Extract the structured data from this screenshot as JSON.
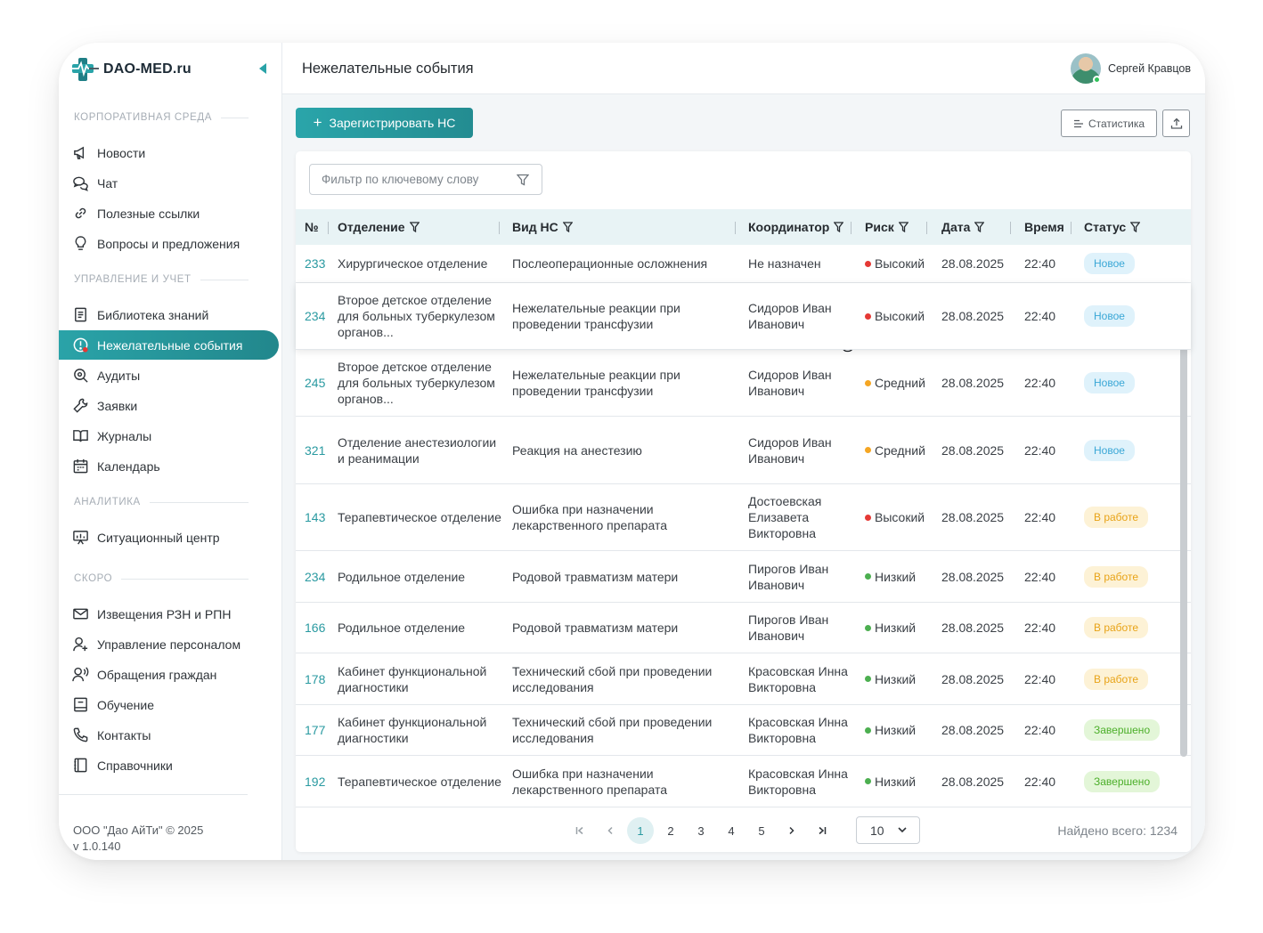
{
  "app": {
    "logo_text": "DAO-MED.ru"
  },
  "sidebar": {
    "sections": [
      {
        "title": "КОРПОРАТИВНАЯ СРЕДА"
      },
      {
        "title": "УПРАВЛЕНИЕ И УЧЕТ"
      },
      {
        "title": "АНАЛИТИКА"
      },
      {
        "title": "СКОРО"
      }
    ],
    "items": [
      {
        "label": "Новости",
        "icon": "megaphone-icon"
      },
      {
        "label": "Чат",
        "icon": "chat-icon"
      },
      {
        "label": "Полезные ссылки",
        "icon": "link-icon"
      },
      {
        "label": "Вопросы и предложения",
        "icon": "lightbulb-icon"
      },
      {
        "label": "Библиотека знаний",
        "icon": "book-list-icon"
      },
      {
        "label": "Нежелательные события",
        "icon": "alert-circle-icon",
        "active": true
      },
      {
        "label": "Аудиты",
        "icon": "magnifier-icon"
      },
      {
        "label": "Заявки",
        "icon": "wrench-icon"
      },
      {
        "label": "Журналы",
        "icon": "open-book-icon"
      },
      {
        "label": "Календарь",
        "icon": "calendar-icon"
      },
      {
        "label": "Ситуационный центр",
        "icon": "presentation-icon"
      },
      {
        "label": "Извещения РЗН и РПН",
        "icon": "mail-icon"
      },
      {
        "label": "Управление персоналом",
        "icon": "user-add-icon"
      },
      {
        "label": "Обращения граждан",
        "icon": "user-voice-icon"
      },
      {
        "label": "Обучение",
        "icon": "board-icon"
      },
      {
        "label": "Контакты",
        "icon": "phone-icon"
      },
      {
        "label": "Справочники",
        "icon": "notebook-icon"
      }
    ],
    "footer": {
      "company": "ООО \"Дао АйТи\" © 2025",
      "version": "v 1.0.140"
    }
  },
  "header": {
    "title": "Нежелательные события",
    "user_name": "Сергей Кравцов"
  },
  "toolbar": {
    "register_label": "Зарегистрировать НС",
    "stats_label": "Статистика"
  },
  "filter": {
    "placeholder": "Фильтр по ключевому слову"
  },
  "table": {
    "columns": [
      "№",
      "Отделение",
      "Вид НС",
      "Координатор",
      "Риск",
      "Дата",
      "Время",
      "Статус"
    ],
    "rows": [
      {
        "no": "233",
        "dept": "Хирургическое отделение",
        "type": "Послеоперационные осложнения",
        "coord": "Не назначен",
        "risk": "Высокий",
        "date": "28.08.2025",
        "time": "22:40",
        "status": "Новое"
      },
      {
        "no": "234",
        "dept": "Второе детское отделение для больных туберкулезом органов...",
        "type": "Нежелательные реакции при проведении трансфузии",
        "coord": "Сидоров Иван Иванович",
        "risk": "Высокий",
        "date": "28.08.2025",
        "time": "22:40",
        "status": "Новое"
      },
      {
        "no": "245",
        "dept": "Второе детское отделение для больных туберкулезом органов...",
        "type": "Нежелательные реакции при проведении трансфузии",
        "coord": "Сидоров Иван Иванович",
        "risk": "Средний",
        "date": "28.08.2025",
        "time": "22:40",
        "status": "Новое"
      },
      {
        "no": "321",
        "dept": "Отделение анестезиологии и реанимации",
        "type": "Реакция на анестезию",
        "coord": "Сидоров Иван Иванович",
        "risk": "Средний",
        "date": "28.08.2025",
        "time": "22:40",
        "status": "Новое"
      },
      {
        "no": "143",
        "dept": "Терапевтическое отделение",
        "type": "Ошибка при назначении лекарственного препарата",
        "coord": "Достоевская Елизавета Викторовна",
        "risk": "Высокий",
        "date": "28.08.2025",
        "time": "22:40",
        "status": "В работе"
      },
      {
        "no": "234",
        "dept": "Родильное отделение",
        "type": "Родовой травматизм матери",
        "coord": "Пирогов Иван Иванович",
        "risk": "Низкий",
        "date": "28.08.2025",
        "time": "22:40",
        "status": "В работе"
      },
      {
        "no": "166",
        "dept": "Родильное отделение",
        "type": "Родовой травматизм матери",
        "coord": "Пирогов Иван Иванович",
        "risk": "Низкий",
        "date": "28.08.2025",
        "time": "22:40",
        "status": "В работе"
      },
      {
        "no": "178",
        "dept": "Кабинет функциональной диагностики",
        "type": "Технический сбой при проведении исследования",
        "coord": "Красовская Инна Викторовна",
        "risk": "Низкий",
        "date": "28.08.2025",
        "time": "22:40",
        "status": "В работе"
      },
      {
        "no": "177",
        "dept": "Кабинет функциональной диагностики",
        "type": "Технический сбой при проведении исследования",
        "coord": "Красовская Инна Викторовна",
        "risk": "Низкий",
        "date": "28.08.2025",
        "time": "22:40",
        "status": "Завершено"
      },
      {
        "no": "192",
        "dept": "Терапевтическое отделение",
        "type": "Ошибка при назначении лекарственного препарата",
        "coord": "Красовская Инна Викторовна",
        "risk": "Низкий",
        "date": "28.08.2025",
        "time": "22:40",
        "status": "Завершено"
      }
    ]
  },
  "risk_colors": {
    "Высокий": "#e53935",
    "Средний": "#f5a623",
    "Низкий": "#4caf50"
  },
  "status_styles": {
    "Новое": {
      "bg": "#dff2fb",
      "fg": "#3aa7d6"
    },
    "В работе": {
      "bg": "#fdf2d6",
      "fg": "#e8a317"
    },
    "Завершено": {
      "bg": "#e3f6d8",
      "fg": "#4caf2a"
    }
  },
  "pagination": {
    "pages": [
      "1",
      "2",
      "3",
      "4",
      "5"
    ],
    "current": "1",
    "page_size": "10",
    "total_label": "Найдено всего: 1234"
  },
  "colors": {
    "accent": "#2aa3a8"
  }
}
